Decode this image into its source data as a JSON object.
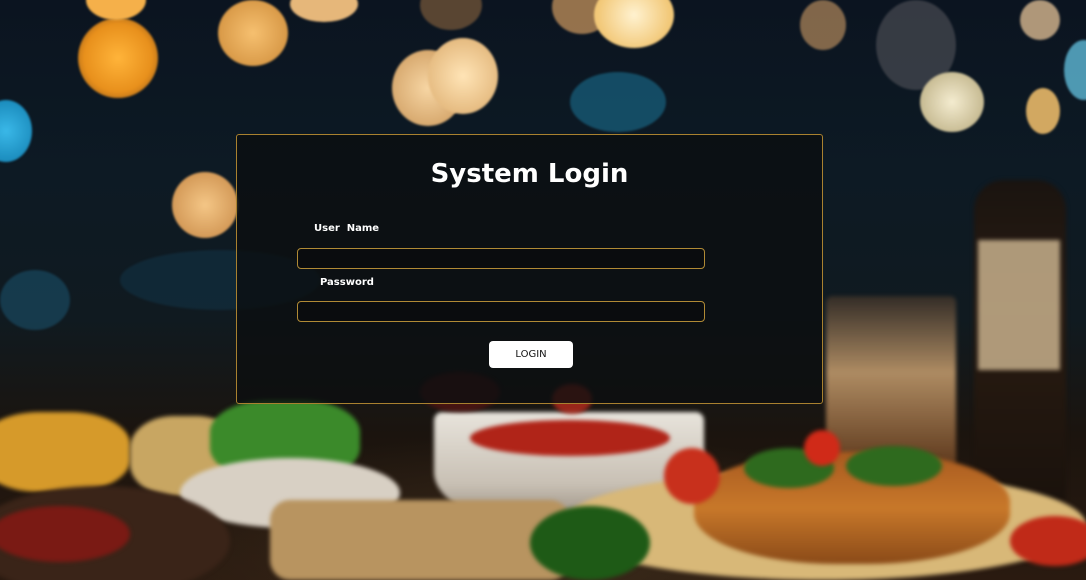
{
  "login": {
    "title": "System Login",
    "username_label": "User  Name",
    "username_value": "",
    "password_label": "Password",
    "password_value": "",
    "button_label": "LOGIN"
  },
  "colors": {
    "panel_border": "#a9812f",
    "field_border": "#b08a35",
    "button_bg": "#ffffff",
    "title_text": "#ffffff"
  }
}
